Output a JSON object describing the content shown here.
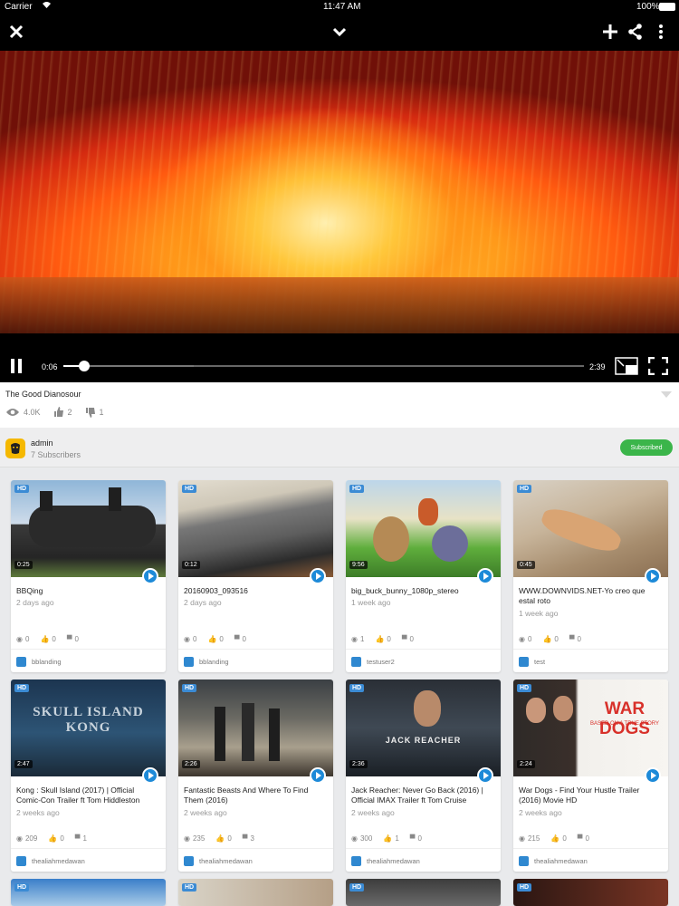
{
  "status_bar": {
    "carrier": "Carrier",
    "time": "11:47 AM",
    "battery": "100%"
  },
  "player": {
    "current_time": "0:06",
    "total_time": "2:39",
    "progress": 0.04,
    "buffered": 0.25
  },
  "video": {
    "title": "The Good Dianosour",
    "views": "4.0K",
    "likes": "2",
    "dislikes": "1"
  },
  "channel": {
    "name": "admin",
    "subscribers": "7 Subscribers",
    "subscribe_label": "Subscribed"
  },
  "cards": [
    {
      "title": "BBQing",
      "ago": "2 days ago",
      "duration": "0:25",
      "hd": "HD",
      "views": "0",
      "likes": "0",
      "comments": "0",
      "user": "bblanding"
    },
    {
      "title": "20160903_093516",
      "ago": "2 days ago",
      "duration": "0:12",
      "hd": "HD",
      "views": "0",
      "likes": "0",
      "comments": "0",
      "user": "bblanding"
    },
    {
      "title": "big_buck_bunny_1080p_stereo",
      "ago": "1 week ago",
      "duration": "9:56",
      "hd": "HD",
      "views": "1",
      "likes": "0",
      "comments": "0",
      "user": "testuser2"
    },
    {
      "title": "WWW.DOWNVIDS.NET-Yo creo que estal roto",
      "ago": "1 week ago",
      "duration": "0:45",
      "hd": "HD",
      "views": "0",
      "likes": "0",
      "comments": "0",
      "user": "test"
    },
    {
      "title": "Kong : Skull Island (2017) | Official Comic-Con Trailer ft Tom Hiddleston",
      "ago": "2 weeks ago",
      "duration": "2:47",
      "hd": "HD",
      "views": "209",
      "likes": "0",
      "comments": "1",
      "user": "thealiahmedawan"
    },
    {
      "title": "Fantastic Beasts And Where To Find Them (2016)",
      "ago": "2 weeks ago",
      "duration": "2:26",
      "hd": "HD",
      "views": "235",
      "likes": "0",
      "comments": "3",
      "user": "thealiahmedawan"
    },
    {
      "title": "Jack Reacher: Never Go Back (2016) | Official IMAX Trailer ft Tom Cruise",
      "ago": "2 weeks ago",
      "duration": "2:36",
      "hd": "HD",
      "views": "300",
      "likes": "1",
      "comments": "0",
      "user": "thealiahmedawan"
    },
    {
      "title": "War Dogs - Find Your Hustle Trailer (2016) Movie HD",
      "ago": "2 weeks ago",
      "duration": "2:24",
      "hd": "HD",
      "views": "215",
      "likes": "0",
      "comments": "0",
      "user": "thealiahmedawan"
    }
  ],
  "thumb_texts": {
    "kong": "SKULL ISLAND KONG",
    "reacher": "JACK REACHER",
    "wardogs": "WAR DOGS",
    "wardogs_tag": "BASED ON A TRUE STORY"
  },
  "bottom_row_hd": [
    "HD",
    "HD",
    "HD",
    "HD"
  ],
  "colors": {
    "accent": "#1d8ad8",
    "subscribe": "#3bb54a",
    "hd_badge": "#3b8bd4"
  }
}
